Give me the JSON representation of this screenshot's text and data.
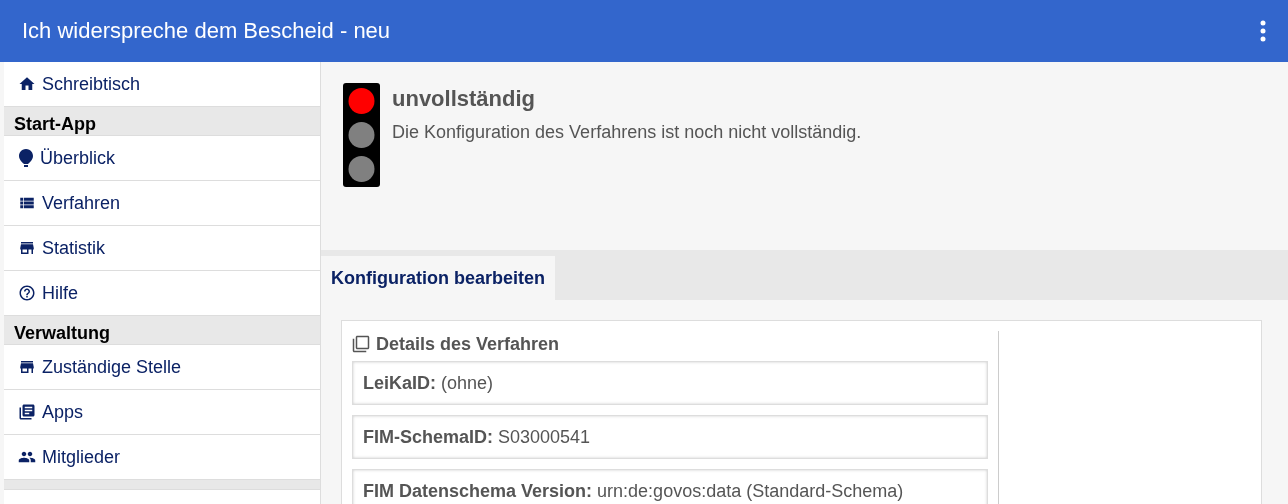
{
  "header": {
    "title": "Ich widerspreche dem Bescheid - neu"
  },
  "sidebar": {
    "items": [
      {
        "kind": "link",
        "label": "Schreibtisch"
      },
      {
        "kind": "header",
        "label": "Start-App"
      },
      {
        "kind": "link",
        "label": "Überblick"
      },
      {
        "kind": "link",
        "label": "Verfahren"
      },
      {
        "kind": "link",
        "label": "Statistik"
      },
      {
        "kind": "link",
        "label": "Hilfe"
      },
      {
        "kind": "header",
        "label": "Verwaltung"
      },
      {
        "kind": "link",
        "label": "Zuständige Stelle"
      },
      {
        "kind": "link",
        "label": "Apps"
      },
      {
        "kind": "link",
        "label": "Mitglieder"
      },
      {
        "kind": "spacer"
      }
    ]
  },
  "status": {
    "lights": [
      {
        "on": true
      },
      {
        "on": false
      },
      {
        "on": false
      }
    ],
    "title": "unvollständig",
    "message": "Die Konfiguration des Verfahrens ist noch nicht vollständig."
  },
  "tabs": [
    {
      "label": "Konfiguration bearbeiten",
      "selected": true
    }
  ],
  "details": {
    "title": "Details des Verfahren",
    "fields": [
      "**LeiKaID:** (ohne)",
      "**FIM-SchemaID:** S03000541",
      "**FIM Datenschema Version:** urn:de:govos:data (Standard-Schema)"
    ]
  }
}
